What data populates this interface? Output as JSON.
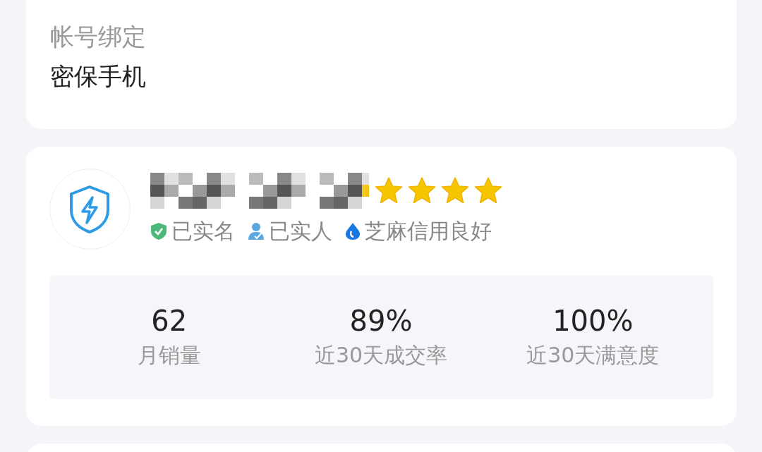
{
  "account": {
    "label": "帐号绑定",
    "value": "密保手机"
  },
  "seller": {
    "stars": 4,
    "badges": [
      {
        "kind": "shield",
        "label": "已实名"
      },
      {
        "kind": "person",
        "label": "已实人"
      },
      {
        "kind": "drop",
        "label": "芝麻信用良好"
      }
    ],
    "stats": [
      {
        "value": "62",
        "label": "月销量"
      },
      {
        "value": "89%",
        "label": "近30天成交率"
      },
      {
        "value": "100%",
        "label": "近30天满意度"
      }
    ]
  }
}
